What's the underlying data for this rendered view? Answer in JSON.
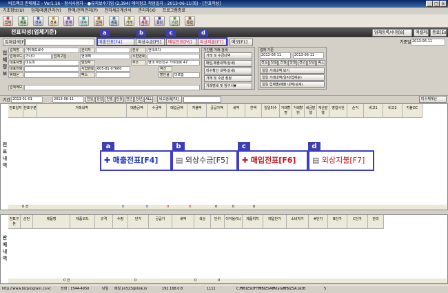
{
  "window": {
    "title": "비즈팩크 판매재고 - Ver1.16 - 정식사용자 - ●유지보수가입 (2,394) 에이핑크       작업일자 : 2013-06-11(화) - [전표작성]",
    "min": "_",
    "max": "□",
    "close": "x"
  },
  "menu": [
    "기초정보(U)",
    "업체/제품관리(Y)",
    "판매/견적관리(P)",
    "전자세금계산서",
    "관리자(X)",
    "프로그램종료"
  ],
  "toolbar": [
    {
      "label": "업체관리",
      "icon": "building-icon"
    },
    {
      "label": "제품관리",
      "icon": "box-icon"
    },
    {
      "label": "전표작성",
      "icon": "document-icon"
    },
    {
      "label": "전표리스트",
      "icon": "list-icon"
    },
    {
      "label": "현재재고",
      "icon": "stock-icon"
    },
    {
      "label": "미수미지급",
      "icon": "money-icon"
    },
    {
      "label": "업체별원장",
      "icon": "ledger-icon"
    },
    {
      "label": "제품별재고",
      "icon": "inventory-icon"
    },
    {
      "label": "거래처명세",
      "icon": "statement-icon"
    },
    {
      "label": "세금계산서",
      "icon": "tax-icon"
    },
    {
      "label": "결산",
      "icon": "chart-icon"
    },
    {
      "label": "기간별현황",
      "icon": "period-icon"
    },
    {
      "label": "통합검색",
      "icon": "search-icon"
    }
  ],
  "header": {
    "title": "전표작성(업체기준)",
    "right_buttons": [
      "업체등록/수정[8]",
      "엑셀저장",
      "종료[Esc]"
    ]
  },
  "action_bar": {
    "search_label": "업체검색[F2]",
    "buttons": [
      "매출전표[F4]",
      "외상수금[F5]",
      "매입전표[F6]",
      "외상지불[F7]",
      "메모[F1]"
    ],
    "date_label": "기준일",
    "date": "2013-06-11"
  },
  "badges": [
    "a",
    "b",
    "c",
    "d"
  ],
  "company_info": {
    "side_label": "업체정보",
    "labels": [
      "업체명",
      "업체코드",
      "대표자명",
      "대표전화",
      "휴대폰",
      "업체메모",
      "관리자",
      "담당자",
      "사업번호",
      "팩스",
      "분류",
      "우편번호",
      "주소"
    ],
    "values": [
      "(주)메도로수",
      "가나다",
      "미도미",
      "",
      "",
      "",
      "",
      "현대팩",
      "605-81-07660",
      "",
      "현대코다",
      "",
      "현대 부산진구 가야대로 47"
    ],
    "sub_labels": [
      "업체구분",
      "거래처",
      "여신",
      "잔액",
      "할인율",
      "부가세"
    ],
    "sub_values": [
      "",
      "",
      "0",
      "0",
      "0",
      "미포함"
    ]
  },
  "trade_query": {
    "title": "기간별 거래 검색",
    "buttons": [
      "거래 및 수금내역",
      "매입,매출내역(상세)",
      "미수확인 내역(상세)",
      "거래 및 수금 정정",
      "거래명세 및 청구서▼"
    ]
  },
  "filter_query": {
    "title": "업체 기준",
    "dates": [
      "2013-06-11",
      "2013-06-11"
    ],
    "buttons": [
      "전일",
      "당일",
      "전월",
      "당월",
      "전년",
      "당년",
      "ALL",
      "일일 거래내역 보기",
      "일일 거래내역(일자/업체순)",
      "일일 업체별/매출 내역(상세)"
    ]
  },
  "period_bar": {
    "label": "기간",
    "from": "2013-01-01",
    "to": "2013-06-11",
    "quick": [
      "전일",
      "당일",
      "전월",
      "당월",
      "전년",
      "당년",
      "ALL"
    ],
    "search": "비고검색[F3]",
    "right": "미수채계산"
  },
  "top_grid": {
    "side_label": "전표내역",
    "headers": [
      "전표일자",
      "전표구분",
      "거래내역",
      "매출금액",
      "수금액",
      "매입금액",
      "지불액",
      "공급가액",
      "세액",
      "잔액",
      "일일미수",
      "거래할명",
      "거래할번",
      "세금발행",
      "계산발행",
      "영업사원",
      "순익",
      "비고1",
      "비고2",
      "지불OC"
    ],
    "footer": {
      "count": "0 건",
      "vals": [
        "0",
        "0",
        "0",
        "0",
        "0",
        "0",
        "0"
      ]
    }
  },
  "big_buttons": [
    {
      "label": "매출전표[F4]",
      "color": "#1a34c8"
    },
    {
      "label": "외상수금[F5]",
      "color": "#2a2a2a"
    },
    {
      "label": "매입전표[F6]",
      "color": "#c8141e"
    },
    {
      "label": "외상지불[F7]",
      "color": "#c8141e"
    }
  ],
  "bottom_grid": {
    "side_label": "판매내역",
    "headers": [
      "전표구분",
      "순번",
      "제품명",
      "제품코드",
      "규격",
      "수량",
      "단가",
      "공급가",
      "세액",
      "색상",
      "단위",
      "이익율(%)",
      "제품위치",
      "매입단가",
      "소비자가",
      "#단가",
      "B단가",
      "C단가",
      "관리"
    ],
    "footer": {
      "count": "0 건",
      "vals": [
        "0",
        "0",
        "0"
      ]
    }
  },
  "status": {
    "url": "http://www.bizprogram.co.kr",
    "phone": "전화 : 1544-4950",
    "mode": "단일",
    "email": "메일 jin523@ilink.kr",
    "ip": "192.168.0.8",
    "num": "1111",
    "path": "C:₩BIZSOFT₩BIZSA₩data₩BIZSA.GDB",
    "extra": "5"
  }
}
